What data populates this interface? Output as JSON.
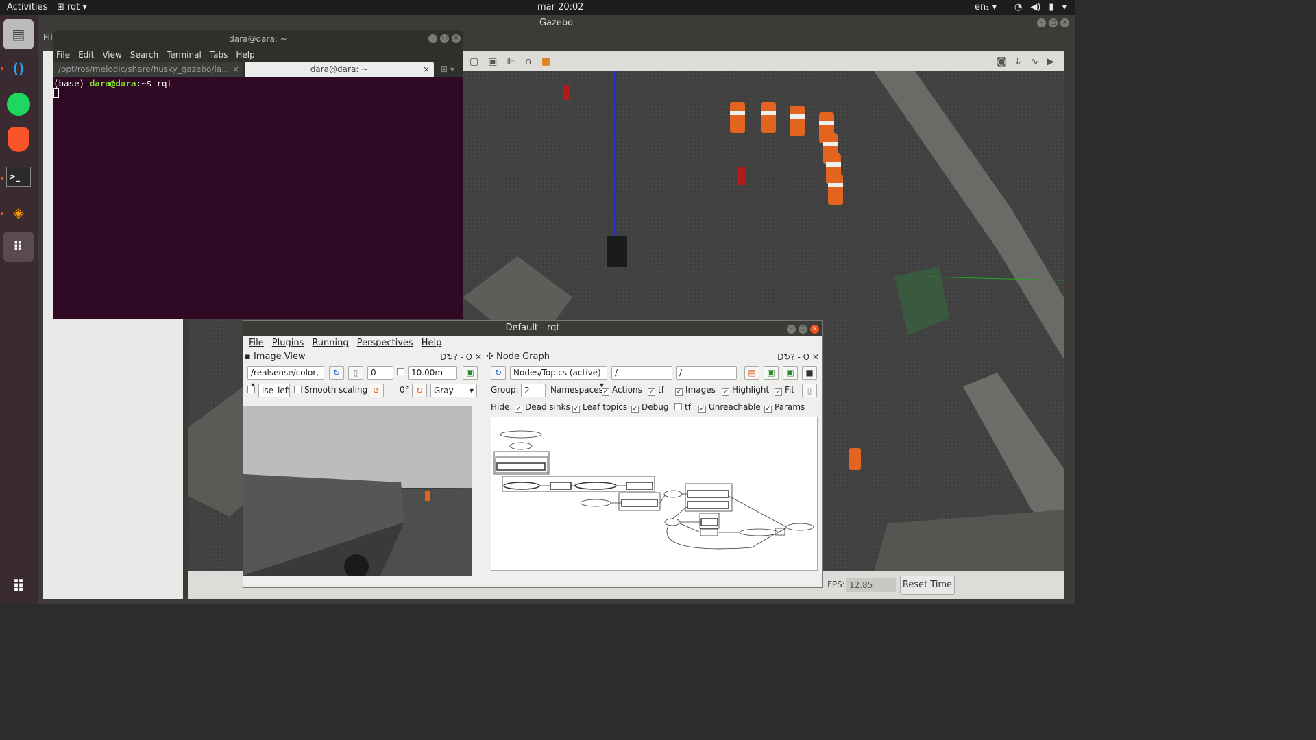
{
  "topbar": {
    "activities": "Activities",
    "app_name": "rqt",
    "clock": "mar 20:02",
    "lang": "en₁"
  },
  "dock": {
    "items": [
      {
        "name": "files"
      },
      {
        "name": "vscode"
      },
      {
        "name": "spotify"
      },
      {
        "name": "brave"
      },
      {
        "name": "terminal"
      },
      {
        "name": "sublime"
      },
      {
        "name": "apps-grid"
      }
    ]
  },
  "gazebo": {
    "title": "Gazebo",
    "menu_file": "Fil",
    "fps_label": "FPS:",
    "fps_value": "12.85",
    "reset_time": "Reset Time"
  },
  "terminal": {
    "title": "dara@dara: ~",
    "menu": [
      "File",
      "Edit",
      "View",
      "Search",
      "Terminal",
      "Tabs",
      "Help"
    ],
    "tab1": "/opt/ros/melodic/share/husky_gazebo/la...",
    "tab2": "dara@dara: ~",
    "prompt_env": "(base) ",
    "prompt_user": "dara@dara",
    "prompt_path": ":~$ ",
    "command": "rqt"
  },
  "rqt": {
    "title": "Default - rqt",
    "menu": [
      "File",
      "Plugins",
      "Running",
      "Perspectives",
      "Help"
    ],
    "image_view": {
      "title": "Image View",
      "topic": "/realsense/color,",
      "index": "0",
      "distance": "10.00m",
      "topic2": "ise_left",
      "smooth_scaling": "Smooth scaling",
      "rotation": "0°",
      "color_mode": "Gray"
    },
    "node_graph": {
      "title": "Node Graph",
      "mode": "Nodes/Topics (active)",
      "filter1": "/",
      "filter2": "/",
      "group_label": "Group:",
      "group_value": "2",
      "namespaces": "Namespaces",
      "actions": "Actions",
      "tf": "tf",
      "images": "Images",
      "highlight": "Highlight",
      "fit": "Fit",
      "hide_label": "Hide:",
      "dead_sinks": "Dead sinks",
      "leaf_topics": "Leaf topics",
      "debug": "Debug",
      "tf2": "tf",
      "unreachable": "Unreachable",
      "params": "Params"
    }
  }
}
